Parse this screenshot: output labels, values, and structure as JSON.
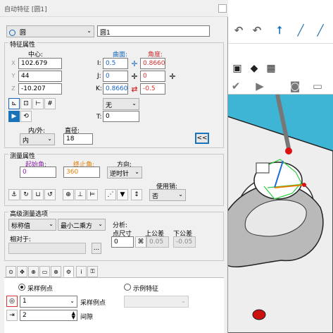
{
  "window": {
    "title": "自动特征 [圆1]"
  },
  "feature": {
    "type": "圆",
    "name": "圆1"
  },
  "feature_props": {
    "group_label": "特征属性",
    "center_label": "中心:",
    "surface_label": "曲面:",
    "angle_label": "角度:",
    "x": "102.679",
    "y": "44",
    "z": "-10.207",
    "x_axis": "X",
    "y_axis": "Y",
    "z_axis": "Z",
    "i_label": "I:",
    "j_label": "J:",
    "k_label": "K:",
    "i_surface": "0.5",
    "j_surface": "0",
    "k_surface": "0.86602",
    "i_angle": "0.86602",
    "j_angle": "0",
    "k_angle": "-0.5",
    "none_option": "无",
    "t_label": "T:",
    "t_value": "0",
    "inout_label": "内/外:",
    "inout_value": "内",
    "diameter_label": "直径:",
    "diameter_value": "18",
    "collapse_label": "<<"
  },
  "measure_props": {
    "group_label": "测量属性",
    "start_angle_label": "起始角:",
    "start_angle": "0",
    "end_angle_label": "终止角:",
    "end_angle": "360",
    "direction_label": "方向:",
    "direction": "逆时针",
    "use_pin_label": "使用销:",
    "use_pin": "否"
  },
  "advanced": {
    "group_label": "高级测量选项",
    "nominal": "标称值",
    "fit": "最小二乘方",
    "relative_label": "相对于:",
    "relative_value": "",
    "browse_label": "...",
    "analysis_label": "分析:",
    "point_size_label": "点尺寸",
    "point_size": "0",
    "upper_tol_label": "上公差",
    "lower_tol_label": "下公差",
    "upper_tol": "0.05",
    "lower_tol": "-0.05"
  },
  "sampling": {
    "sample_points_radio": "采样例点",
    "sample_feature_radio": "示例特征",
    "sample_count": "1",
    "sample_count_label": "采样例点",
    "spacing": "2",
    "spacing_label": "间隙"
  },
  "colors": {
    "accent": "#1a72b8",
    "cad_bg": "#3fb5d6"
  }
}
